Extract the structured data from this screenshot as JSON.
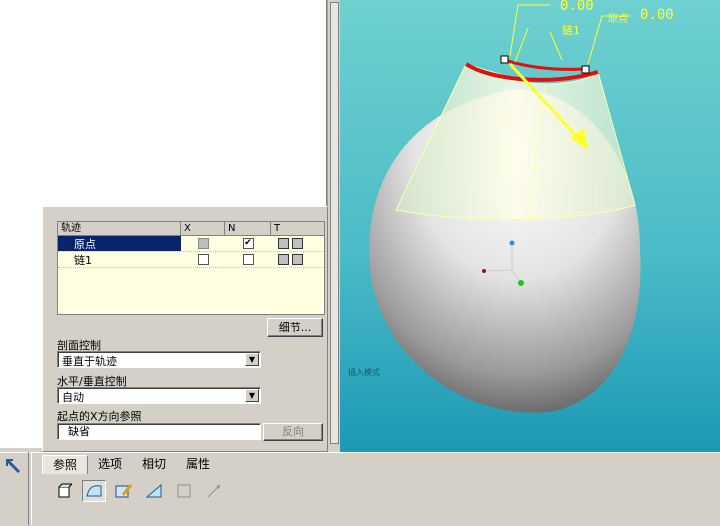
{
  "trajectory_table": {
    "headers": [
      "轨迹",
      "X",
      "N",
      "T"
    ],
    "rows": [
      {
        "name": "原点",
        "x_checked": false,
        "x_disabled": true,
        "n_checked": true,
        "selected": true
      },
      {
        "name": "链1",
        "x_checked": false,
        "x_disabled": false,
        "n_checked": false,
        "selected": false
      }
    ]
  },
  "details_button": "细节...",
  "section_control": {
    "label": "剖面控制",
    "value": "垂直于轨迹"
  },
  "hv_control": {
    "label": "水平/垂直控制",
    "value": "自动"
  },
  "start_x_ref": {
    "label": "起点的X方向参照",
    "value": "缺省",
    "flip_button": "反向"
  },
  "tabs": [
    {
      "label": "参照",
      "active": true
    },
    {
      "label": "选项",
      "active": false
    },
    {
      "label": "相切",
      "active": false
    },
    {
      "label": "属性",
      "active": false
    }
  ],
  "viewport": {
    "dim_top": "0.00",
    "dim_right": "0.00",
    "chain_label": "链1",
    "origin_label": "原点",
    "overlay_text": "插入模式"
  },
  "tools": [
    "solid-icon",
    "surface-icon",
    "sketch-icon",
    "taper-icon",
    "rectangle-icon",
    "trim-icon"
  ]
}
